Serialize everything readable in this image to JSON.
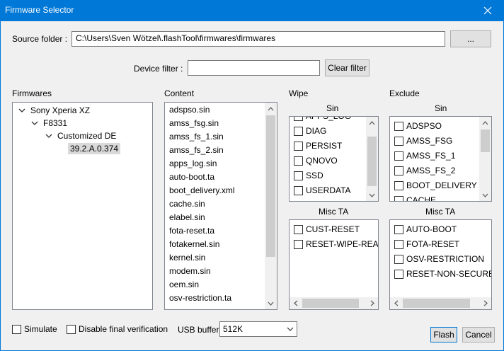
{
  "window": {
    "title": "Firmware Selector"
  },
  "source": {
    "label": "Source folder :",
    "value": "C:\\Users\\Sven Wötzel\\.flashTool\\firmwares\\firmwares",
    "browse_label": "..."
  },
  "filter": {
    "label": "Device filter :",
    "value": "",
    "clear_label": "Clear filter"
  },
  "firmwares": {
    "title": "Firmwares",
    "tree": {
      "device": "Sony Xperia XZ",
      "model": "F8331",
      "customization": "Customized DE",
      "version": "39.2.A.0.374"
    }
  },
  "content": {
    "title": "Content",
    "items": [
      "adspso.sin",
      "amss_fsg.sin",
      "amss_fs_1.sin",
      "amss_fs_2.sin",
      "apps_log.sin",
      "auto-boot.ta",
      "boot_delivery.xml",
      "cache.sin",
      "elabel.sin",
      "fota-reset.ta",
      "fotakernel.sin",
      "kernel.sin",
      "modem.sin",
      "oem.sin",
      "osv-restriction.ta"
    ]
  },
  "wipe": {
    "title": "Wipe",
    "sin_title": "Sin",
    "sin_items": [
      "APPS_LOG",
      "DIAG",
      "PERSIST",
      "QNOVO",
      "SSD",
      "USERDATA"
    ],
    "ta_title": "Misc TA",
    "ta_items": [
      "CUST-RESET",
      "RESET-WIPE-REASON"
    ]
  },
  "exclude": {
    "title": "Exclude",
    "sin_title": "Sin",
    "sin_items": [
      "ADSPSO",
      "AMSS_FSG",
      "AMSS_FS_1",
      "AMSS_FS_2",
      "BOOT_DELIVERY",
      "CACHE"
    ],
    "ta_title": "Misc TA",
    "ta_items": [
      "AUTO-BOOT",
      "FOTA-RESET",
      "OSV-RESTRICTION",
      "RESET-NON-SECURE-ADC"
    ]
  },
  "options": {
    "simulate_label": "Simulate",
    "disable_verification_label": "Disable final verification",
    "usb_buffer_label": "USB buffer",
    "usb_buffer_value": "512K"
  },
  "actions": {
    "flash_label": "Flash",
    "cancel_label": "Cancel"
  },
  "icons": {
    "close": "close-icon",
    "chevron": "chevron-down-icon",
    "scroll_up": "arrow-up-icon",
    "scroll_down": "arrow-down-icon"
  },
  "colors": {
    "titlebar": "#0078d7",
    "selection": "#d9d9d9"
  }
}
